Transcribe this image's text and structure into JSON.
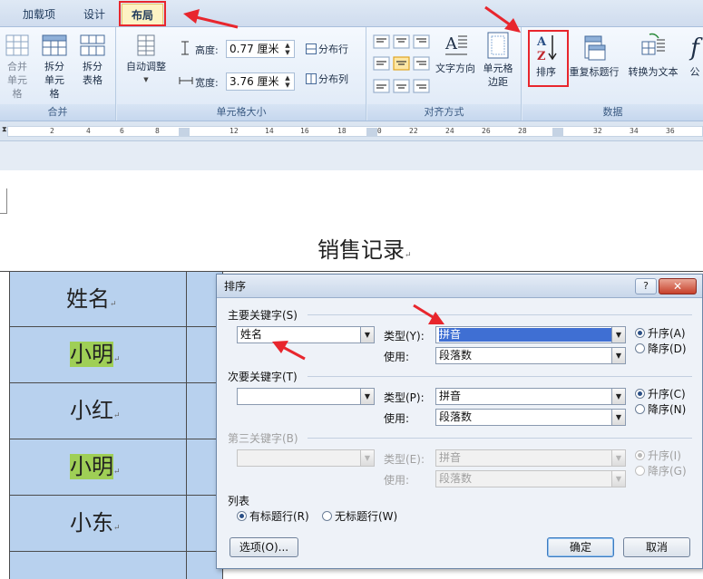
{
  "tabs": [
    {
      "label": "加载项",
      "active": false
    },
    {
      "label": "设计",
      "active": false
    },
    {
      "label": "布局",
      "active": true
    }
  ],
  "ribbon": {
    "merge_group": {
      "label": "合并",
      "merge_cells": "合并单元格",
      "split_cells": "拆分单元格",
      "split_table": "拆分表格"
    },
    "cell_size_group": {
      "label": "单元格大小",
      "autofit": "自动调整",
      "height_label": "高度:",
      "height_value": "0.77 厘米",
      "width_label": "宽度:",
      "width_value": "3.76 厘米",
      "distribute_rows": "分布行",
      "distribute_cols": "分布列"
    },
    "alignment_group": {
      "label": "对齐方式",
      "text_direction": "文字方向",
      "cell_margins": "单元格边距"
    },
    "data_group": {
      "label": "数据",
      "sort": "排序",
      "repeat_header": "重复标题行",
      "convert_to_text": "转换为文本",
      "formula": "公"
    }
  },
  "ruler": {
    "ticks": [
      "2",
      "4",
      "6",
      "8",
      "12",
      "14",
      "16",
      "18",
      "20",
      "22",
      "24",
      "26",
      "28",
      "32",
      "34",
      "36"
    ]
  },
  "document": {
    "title": "销售记录",
    "names": [
      "姓名",
      "小明",
      "小红",
      "小明",
      "小东"
    ]
  },
  "sort_dialog": {
    "title": "排序",
    "help": "?",
    "close": "✕",
    "primary": {
      "label": "主要关键字(S)",
      "key_value": "姓名",
      "type_label": "类型(Y):",
      "type_value": "拼音",
      "use_label": "使用:",
      "use_value": "段落数",
      "asc": "升序(A)",
      "desc": "降序(D)"
    },
    "secondary": {
      "label": "次要关键字(T)",
      "key_value": "",
      "type_label": "类型(P):",
      "type_value": "拼音",
      "use_label": "使用:",
      "use_value": "段落数",
      "asc": "升序(C)",
      "desc": "降序(N)"
    },
    "tertiary": {
      "label": "第三关键字(B)",
      "key_value": "",
      "type_label": "类型(E):",
      "type_value": "拼音",
      "use_label": "使用:",
      "use_value": "段落数",
      "asc": "升序(I)",
      "desc": "降序(G)"
    },
    "list": {
      "label": "列表",
      "has_header": "有标题行(R)",
      "no_header": "无标题行(W)"
    },
    "options_btn": "选项(O)...",
    "ok_btn": "确定",
    "cancel_btn": "取消"
  },
  "colors": {
    "annotation_red": "#e8262d",
    "table_fill": "#b8d1ee",
    "highlight": "#9fcf56"
  }
}
